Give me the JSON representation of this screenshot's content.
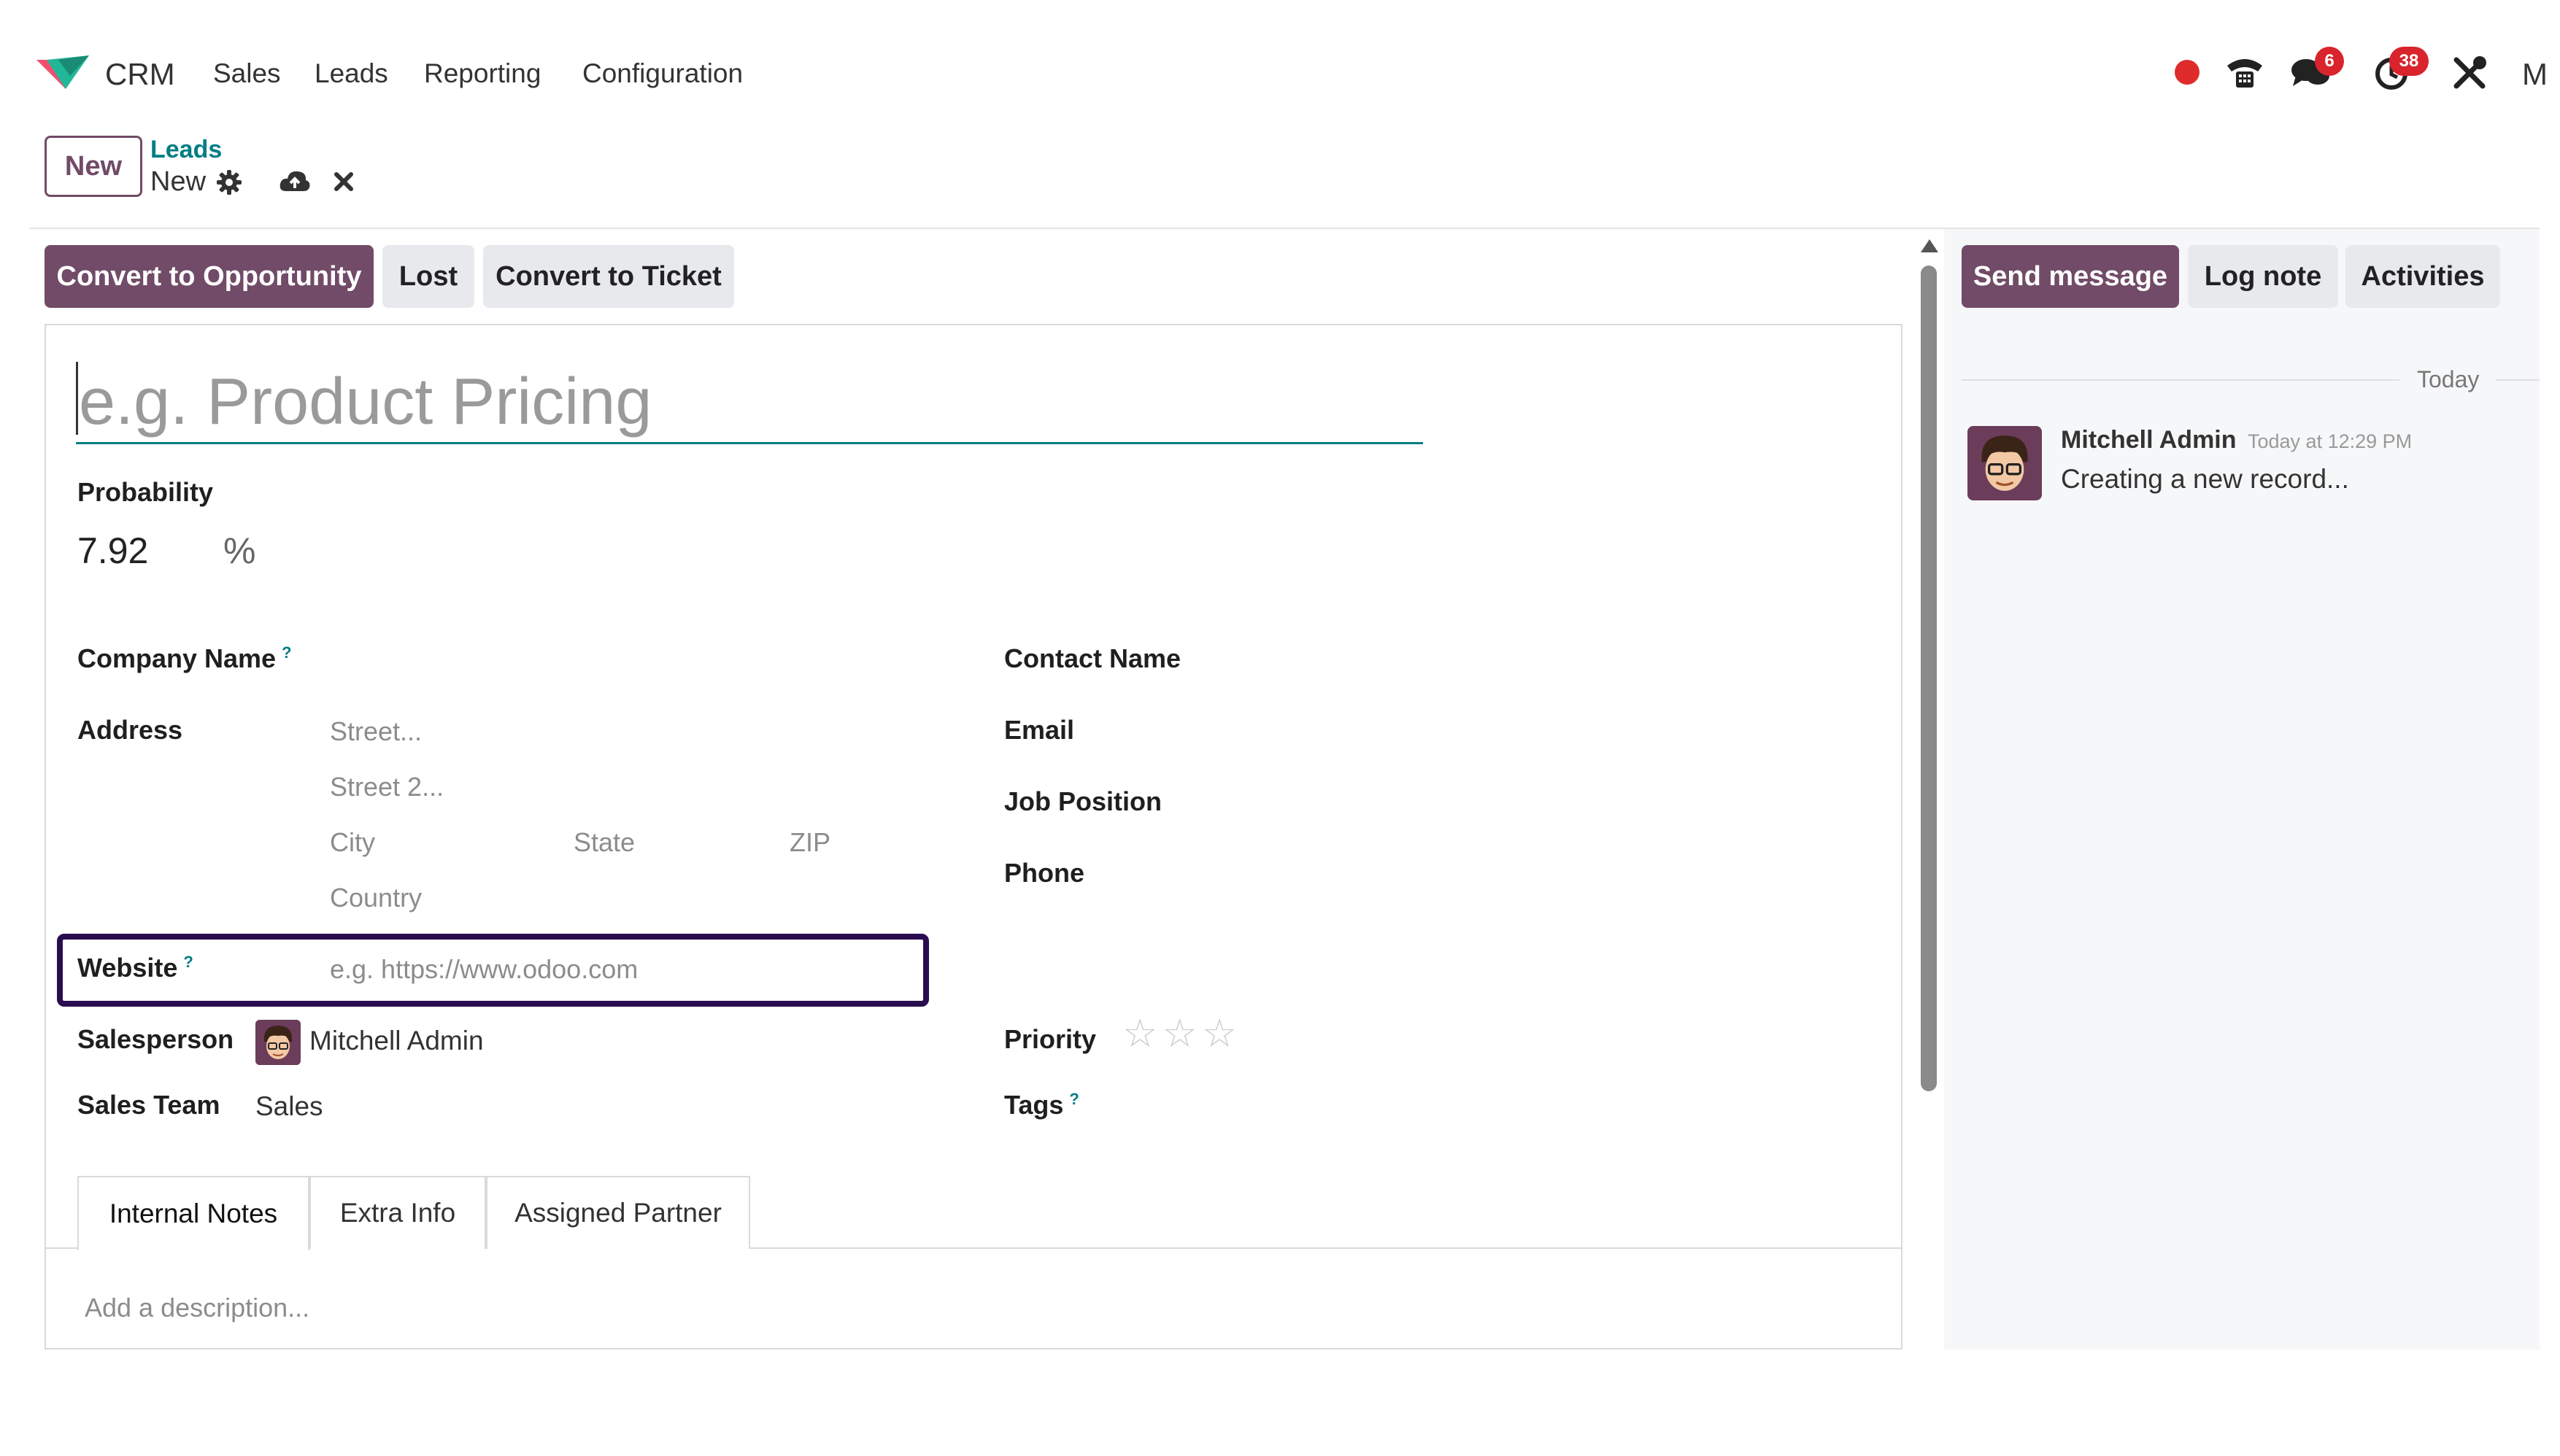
{
  "navbar": {
    "app_name": "CRM",
    "menu": [
      "Sales",
      "Leads",
      "Reporting",
      "Configuration"
    ],
    "messages_badge": "6",
    "activities_badge": "38",
    "user_initial": "M"
  },
  "breadcrumb": {
    "new_button": "New",
    "parent": "Leads",
    "current": "New"
  },
  "statusbar": {
    "convert_opportunity": "Convert to Opportunity",
    "lost": "Lost",
    "convert_ticket": "Convert to Ticket"
  },
  "chatter": {
    "send_message": "Send message",
    "log_note": "Log note",
    "activities": "Activities",
    "date_separator": "Today",
    "message": {
      "author": "Mitchell Admin",
      "time": "Today at 12:29 PM",
      "body": "Creating a new record..."
    }
  },
  "form": {
    "title_placeholder": "e.g. Product Pricing",
    "probability_label": "Probability",
    "probability_value": "7.92",
    "probability_unit": "%",
    "company_name_label": "Company Name",
    "help_mark": "?",
    "address_label": "Address",
    "street_placeholder": "Street...",
    "street2_placeholder": "Street 2...",
    "city_placeholder": "City",
    "state_placeholder": "State",
    "zip_placeholder": "ZIP",
    "country_placeholder": "Country",
    "website_label": "Website",
    "website_placeholder": "e.g. https://www.odoo.com",
    "salesperson_label": "Salesperson",
    "salesperson_value": "Mitchell Admin",
    "sales_team_label": "Sales Team",
    "sales_team_value": "Sales",
    "contact_name_label": "Contact Name",
    "email_label": "Email",
    "job_position_label": "Job Position",
    "phone_label": "Phone",
    "priority_label": "Priority",
    "priority_stars": 3,
    "priority_selected": 0,
    "tags_label": "Tags"
  },
  "tabs": [
    "Internal Notes",
    "Extra Info",
    "Assigned Partner"
  ],
  "notes_placeholder": "Add a description...",
  "colors": {
    "brand": "#714b67",
    "highlight_box": "#2a0d4f",
    "link": "#017e84",
    "badge": "#d9232d"
  }
}
